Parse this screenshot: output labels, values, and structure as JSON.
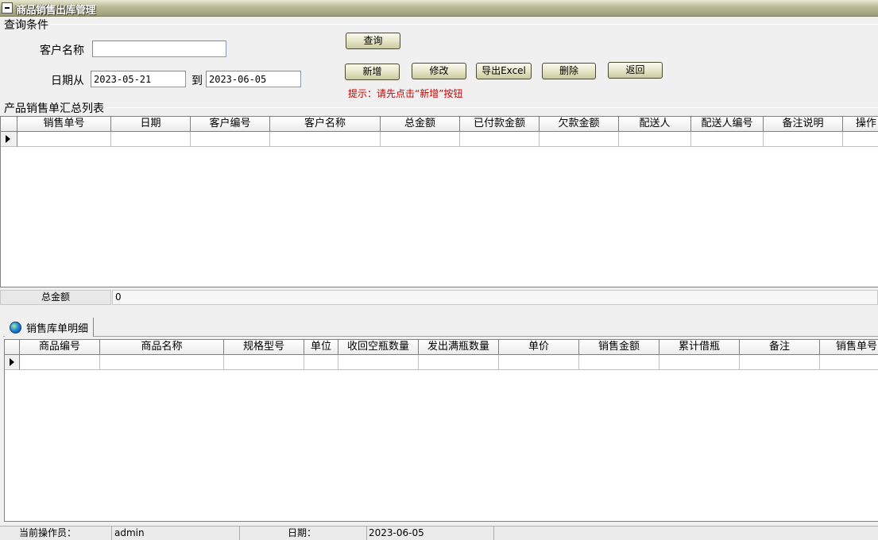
{
  "window": {
    "title": "商品销售出库管理"
  },
  "query": {
    "group_title": "查询条件",
    "customer_label": "客户名称",
    "customer_value": "",
    "date_from_label": "日期从",
    "date_from_value": "2023-05-21",
    "date_to_label": "到",
    "date_to_value": "2023-06-05"
  },
  "buttons": {
    "query": "查询",
    "add": "新增",
    "edit": "修改",
    "export": "导出Excel",
    "delete": "删除",
    "back": "返回"
  },
  "hint": "提示：请先点击“新增”按钮",
  "summary_grid": {
    "group_title": "产品销售单汇总列表",
    "columns": [
      "销售单号",
      "日期",
      "客户编号",
      "客户名称",
      "总金额",
      "已付款金额",
      "欠款金额",
      "配送人",
      "配送人编号",
      "备注说明",
      "操作"
    ]
  },
  "total": {
    "label": "总金额",
    "value": "0"
  },
  "detail_tab": {
    "label": "销售库单明细"
  },
  "detail_grid": {
    "columns": [
      "商品编号",
      "商品名称",
      "规格型号",
      "单位",
      "收回空瓶数量",
      "发出满瓶数量",
      "单价",
      "销售金额",
      "累计借瓶",
      "备注",
      "销售单号"
    ]
  },
  "statusbar": {
    "operator_label": "当前操作员：",
    "operator_value": "admin",
    "date_label": "日期：",
    "date_value": "2023-06-05"
  }
}
